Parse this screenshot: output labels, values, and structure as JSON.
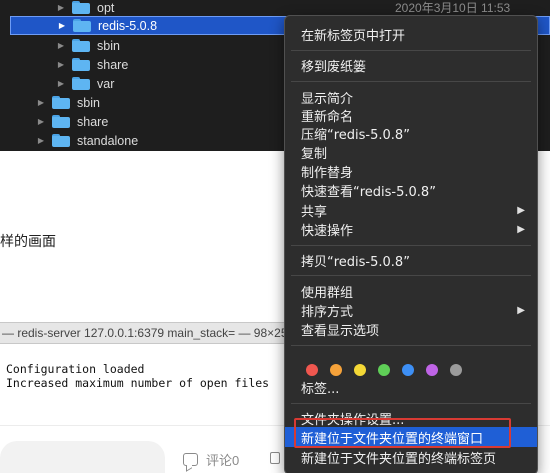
{
  "finder": {
    "rows": [
      {
        "name": "opt",
        "date": "2020年3月10日 11:53"
      },
      {
        "name": "redis-5.0.8",
        "date": ""
      },
      {
        "name": "sbin",
        "date": ""
      },
      {
        "name": "share",
        "date": ""
      },
      {
        "name": "var",
        "date": ""
      },
      {
        "name": "sbin",
        "date": ""
      },
      {
        "name": "share",
        "date": ""
      },
      {
        "name": "standalone",
        "date": ""
      }
    ],
    "disclosure_glyph": "▶"
  },
  "blog": {
    "text": "样的画面",
    "terminal_title": "— redis-server 127.0.0.1:6379 main_stack= — 98×25",
    "terminal_lines": [
      "Configuration loaded",
      "Increased maximum number of open files"
    ],
    "comment_label": "评论0"
  },
  "context_menu": {
    "items": [
      {
        "label": "在新标签页中打开",
        "submenu": false
      },
      {
        "label": "移到废纸篓",
        "submenu": false
      },
      {
        "label": "显示简介",
        "submenu": false
      },
      {
        "label": "重新命名",
        "submenu": false
      },
      {
        "label": "压缩“redis-5.0.8”",
        "submenu": false
      },
      {
        "label": "复制",
        "submenu": false
      },
      {
        "label": "制作替身",
        "submenu": false
      },
      {
        "label": "快速查看“redis-5.0.8”",
        "submenu": false
      },
      {
        "label": "共享",
        "submenu": true
      },
      {
        "label": "快速操作",
        "submenu": true
      },
      {
        "label": "拷贝“redis-5.0.8”",
        "submenu": false
      },
      {
        "label": "使用群组",
        "submenu": false
      },
      {
        "label": "排序方式",
        "submenu": true
      },
      {
        "label": "查看显示选项",
        "submenu": false
      },
      {
        "label": "标签...",
        "submenu": false
      },
      {
        "label": "文件夹操作设置...",
        "submenu": false
      },
      {
        "label": "新建位于文件夹位置的终端窗口",
        "submenu": false
      },
      {
        "label": "新建位于文件夹位置的终端标签页",
        "submenu": false
      }
    ],
    "submenu_glyph": "▶",
    "tag_colors": [
      "#f0574f",
      "#f5a23a",
      "#f4d836",
      "#5fcf57",
      "#3d8ff5",
      "#bf64e6",
      "#9b9b9b"
    ]
  }
}
